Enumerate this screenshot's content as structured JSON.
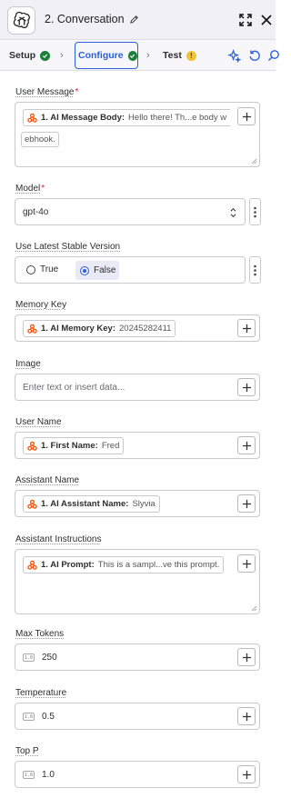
{
  "header": {
    "step_title": "2. Conversation",
    "app_icon": "openai-logo-icon"
  },
  "tabs": [
    {
      "label": "Setup",
      "status": "complete"
    },
    {
      "label": "Configure",
      "status": "complete"
    },
    {
      "label": "Test",
      "status": "warning"
    }
  ],
  "fields": {
    "user_message": {
      "label": "User Message",
      "required": "*",
      "pill_label": "1. AI Message Body:",
      "pill_value": "Hello there! Th...e body w",
      "pill_value_wrap": "ebhook."
    },
    "model": {
      "label": "Model",
      "required": "*",
      "value": "gpt-4o"
    },
    "latest_stable": {
      "label": "Use Latest Stable Version",
      "option_true": "True",
      "option_false": "False",
      "selected": "False"
    },
    "memory_key": {
      "label": "Memory Key",
      "pill_label": "1. AI Memory Key:",
      "pill_value": "20245282411"
    },
    "image": {
      "label": "Image",
      "placeholder": "Enter text or insert data..."
    },
    "user_name": {
      "label": "User Name",
      "pill_label": "1. First Name:",
      "pill_value": "Fred"
    },
    "assistant_name": {
      "label": "Assistant Name",
      "pill_label": "1. AI Assistant Name:",
      "pill_value": "Slyvia"
    },
    "assistant_instructions": {
      "label": "Assistant Instructions",
      "pill_label": "1. AI Prompt:",
      "pill_value": "This is a sampl...ve this prompt."
    },
    "max_tokens": {
      "label": "Max Tokens",
      "value": "250"
    },
    "temperature": {
      "label": "Temperature",
      "value": "0.5"
    },
    "top_p": {
      "label": "Top P",
      "value": "1.0"
    }
  },
  "number_type_badge": "1.0",
  "colors": {
    "accent": "#2b5fd9",
    "success": "#1a7f37",
    "warning": "#f2c230",
    "zapier_orange": "#ff4f00",
    "required": "#d5262c"
  }
}
